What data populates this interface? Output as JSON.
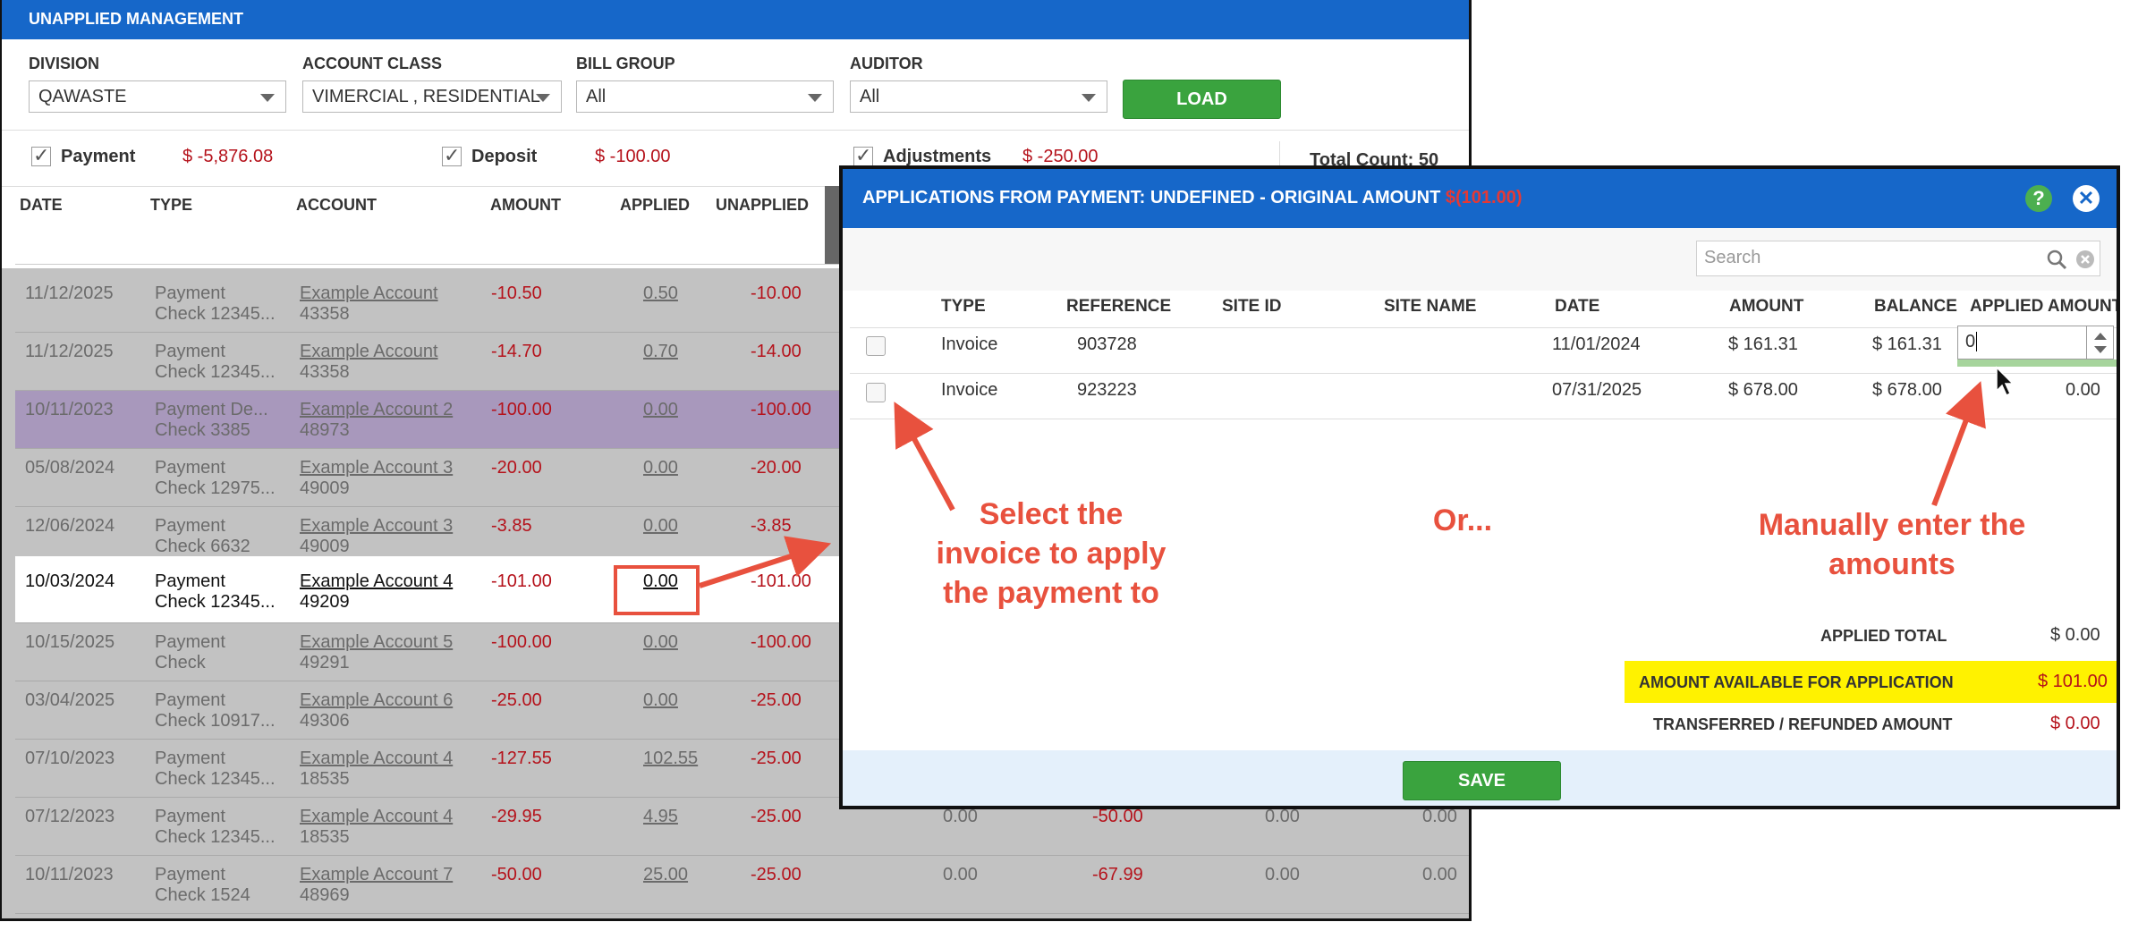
{
  "window": {
    "title": "UNAPPLIED MANAGEMENT"
  },
  "filters": {
    "division": {
      "label": "DIVISION",
      "value": "QAWASTE"
    },
    "account_class": {
      "label": "ACCOUNT CLASS",
      "value": "VIMERCIAL , RESIDENTIAL"
    },
    "bill_group": {
      "label": "BILL GROUP",
      "value": "All"
    },
    "auditor": {
      "label": "AUDITOR",
      "value": "All"
    },
    "load_label": "LOAD"
  },
  "summary": {
    "payment": {
      "label": "Payment",
      "value": "$ -5,876.08",
      "checked": true
    },
    "deposit": {
      "label": "Deposit",
      "value": "$ -100.00",
      "checked": true
    },
    "adjustments": {
      "label": "Adjustments",
      "value": "$ -250.00",
      "checked": true
    },
    "total_count": "Total Count: 50"
  },
  "table": {
    "headers": [
      "DATE",
      "TYPE",
      "ACCOUNT",
      "AMOUNT",
      "APPLIED",
      "UNAPPLIED"
    ],
    "rows": [
      {
        "date": "11/12/2025",
        "type1": "Payment",
        "type2": "Check 12345...",
        "acct1": "Example Account",
        "acct2": "43358",
        "amount": "-10.50",
        "applied": "0.50",
        "unapplied": "-10.00",
        "extra": []
      },
      {
        "date": "11/12/2025",
        "type1": "Payment",
        "type2": "Check 12345...",
        "acct1": "Example Account",
        "acct2": "43358",
        "amount": "-14.70",
        "applied": "0.70",
        "unapplied": "-14.00",
        "extra": []
      },
      {
        "date": "10/11/2023",
        "type1": "Payment De...",
        "type2": "Check 3385",
        "acct1": "Example Account 2",
        "acct2": "48973",
        "amount": "-100.00",
        "applied": "0.00",
        "unapplied": "-100.00",
        "extra": []
      },
      {
        "date": "05/08/2024",
        "type1": "Payment",
        "type2": "Check 12975...",
        "acct1": "Example Account 3",
        "acct2": "49009",
        "amount": "-20.00",
        "applied": "0.00",
        "unapplied": "-20.00",
        "extra": []
      },
      {
        "date": "12/06/2024",
        "type1": "Payment",
        "type2": "Check 6632",
        "acct1": "Example Account 3",
        "acct2": "49009",
        "amount": "-3.85",
        "applied": "0.00",
        "unapplied": "-3.85",
        "extra": []
      },
      {
        "date": "10/03/2024",
        "type1": "Payment",
        "type2": "Check 12345...",
        "acct1": "Example Account 4",
        "acct2": "49209",
        "amount": "-101.00",
        "applied": "0.00",
        "unapplied": "-101.00",
        "extra": []
      },
      {
        "date": "10/15/2025",
        "type1": "Payment",
        "type2": "Check",
        "acct1": "Example Account 5",
        "acct2": "49291",
        "amount": "-100.00",
        "applied": "0.00",
        "unapplied": "-100.00",
        "extra": []
      },
      {
        "date": "03/04/2025",
        "type1": "Payment",
        "type2": "Check 10917...",
        "acct1": "Example Account 6",
        "acct2": "49306",
        "amount": "-25.00",
        "applied": "0.00",
        "unapplied": "-25.00",
        "extra": []
      },
      {
        "date": "07/10/2023",
        "type1": "Payment",
        "type2": "Check 12345...",
        "acct1": "Example Account 4",
        "acct2": "18535",
        "amount": "-127.55",
        "applied": "102.55",
        "unapplied": "-25.00",
        "extra": []
      },
      {
        "date": "07/12/2023",
        "type1": "Payment",
        "type2": "Check 12345...",
        "acct1": "Example Account 4",
        "acct2": "18535",
        "amount": "-29.95",
        "applied": "4.95",
        "unapplied": "-25.00",
        "extra": [
          "0.00",
          "-50.00",
          "0.00",
          "0.00"
        ]
      },
      {
        "date": "10/11/2023",
        "type1": "Payment",
        "type2": "Check 1524",
        "acct1": "Example Account 7",
        "acct2": "48969",
        "amount": "-50.00",
        "applied": "25.00",
        "unapplied": "-25.00",
        "extra": [
          "0.00",
          "-67.99",
          "0.00",
          "0.00"
        ]
      }
    ]
  },
  "modal": {
    "title": "APPLICATIONS FROM PAYMENT: UNDEFINED - ORIGINAL AMOUNT ",
    "title_amount": "$(101.00)",
    "help_glyph": "?",
    "close_glyph": "✕",
    "search_placeholder": "Search",
    "headers": {
      "type": "TYPE",
      "reference": "REFERENCE",
      "site_id": "SITE ID",
      "site_name": "SITE NAME",
      "date": "DATE",
      "amount": "AMOUNT",
      "balance": "BALANCE",
      "applied_amount": "APPLIED AMOUNT"
    },
    "rows": [
      {
        "type": "Invoice",
        "reference": "903728",
        "site_id": "",
        "site_name": "",
        "date": "11/01/2024",
        "amount": "$ 161.31",
        "balance": "$ 161.31",
        "applied": "0"
      },
      {
        "type": "Invoice",
        "reference": "923223",
        "site_id": "",
        "site_name": "",
        "date": "07/31/2025",
        "amount": "$ 678.00",
        "balance": "$ 678.00",
        "applied": "0.00"
      }
    ],
    "totals": {
      "applied_total": {
        "label": "APPLIED TOTAL",
        "value": "$ 0.00"
      },
      "available": {
        "label": "AMOUNT AVAILABLE FOR APPLICATION",
        "value": "$ 101.00"
      },
      "transferred": {
        "label": "TRANSFERRED / REFUNDED AMOUNT",
        "value": "$ 0.00"
      }
    },
    "save_label": "SAVE"
  },
  "annotations": {
    "select_invoice": [
      "Select the",
      "invoice to apply",
      "the payment to"
    ],
    "or": "Or...",
    "manual": [
      "Manually enter the",
      "amounts"
    ]
  },
  "colors": {
    "title_bar": "#1667c9",
    "button_green": "#3aa33e",
    "negative_red": "#b5121b",
    "annotation": "#e8513e",
    "highlight_yellow": "#fff200",
    "selected_row": "#a898bc"
  }
}
